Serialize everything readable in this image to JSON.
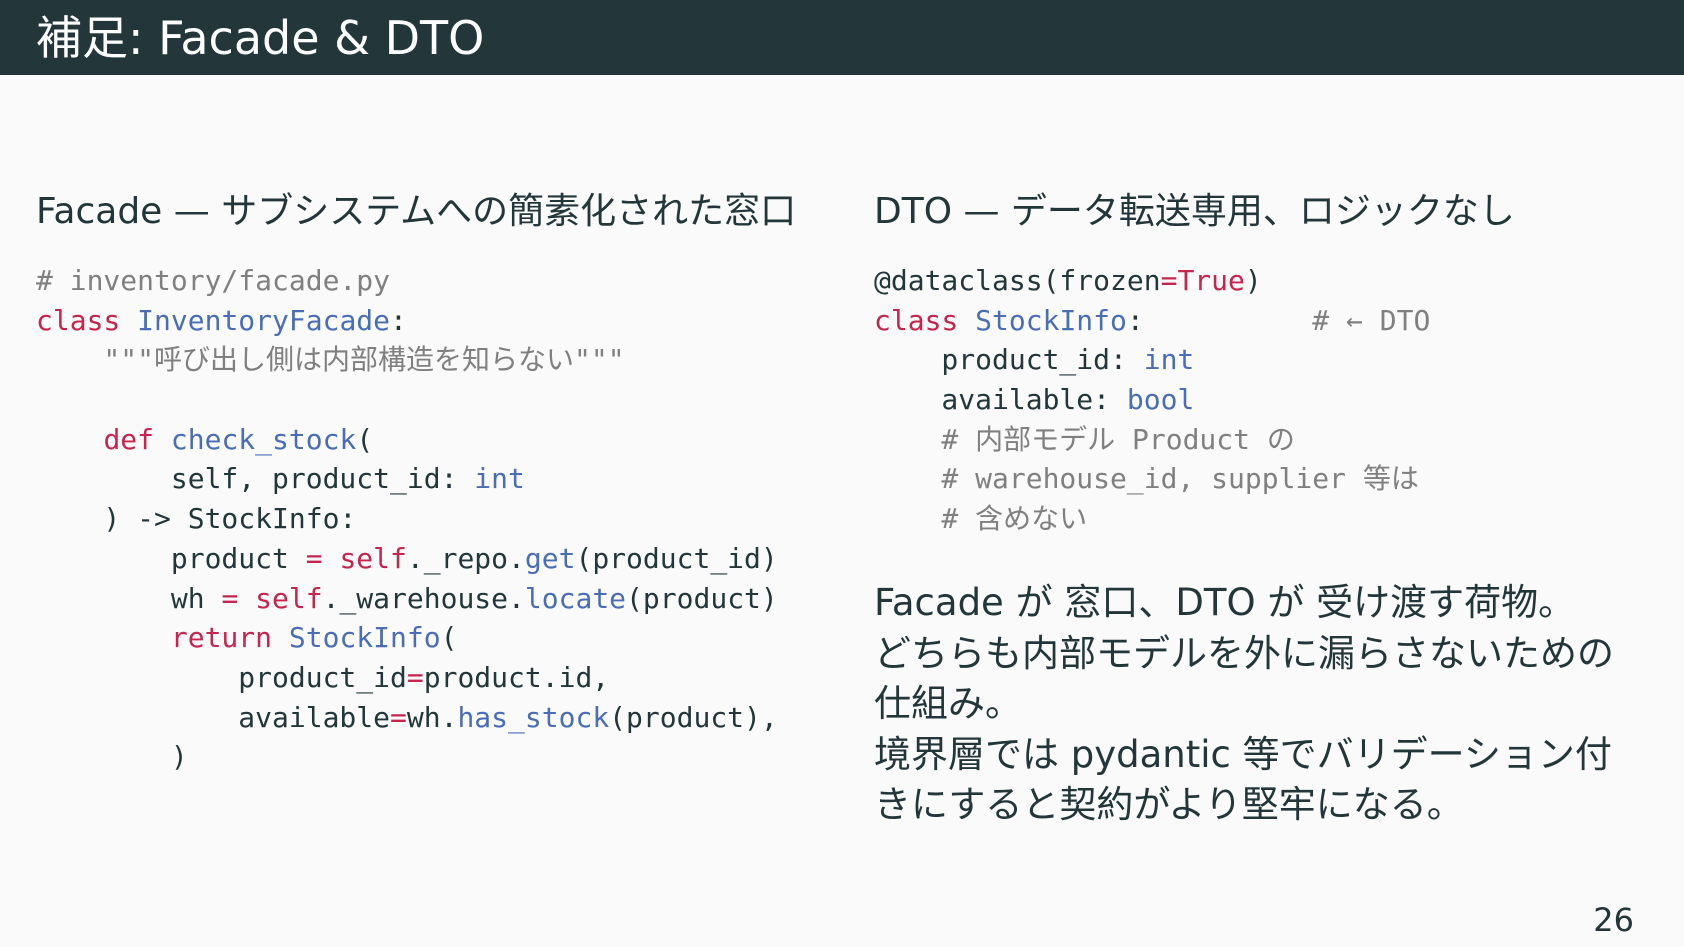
{
  "slide": {
    "title": "補足: Facade & DTO",
    "page_number": "26"
  },
  "left": {
    "heading": "Facade — サブシステムへの簡素化された窓口",
    "code_lines": [
      [
        {
          "t": "# inventory/facade.py",
          "c": "comment"
        }
      ],
      [
        {
          "t": "class",
          "c": "kw"
        },
        {
          "t": " ",
          "c": "plain"
        },
        {
          "t": "InventoryFacade",
          "c": "name"
        },
        {
          "t": ":",
          "c": "plain"
        }
      ],
      [
        {
          "t": "    \"\"\"呼び出し側は内部構造を知らない\"\"\"",
          "c": "comment"
        }
      ],
      [
        {
          "t": "",
          "c": "plain"
        }
      ],
      [
        {
          "t": "    ",
          "c": "plain"
        },
        {
          "t": "def",
          "c": "kw"
        },
        {
          "t": " ",
          "c": "plain"
        },
        {
          "t": "check_stock",
          "c": "name"
        },
        {
          "t": "(",
          "c": "plain"
        }
      ],
      [
        {
          "t": "        self, product_id: ",
          "c": "plain"
        },
        {
          "t": "int",
          "c": "name"
        }
      ],
      [
        {
          "t": "    ) -> StockInfo:",
          "c": "plain"
        }
      ],
      [
        {
          "t": "        product ",
          "c": "plain"
        },
        {
          "t": "=",
          "c": "kw"
        },
        {
          "t": " ",
          "c": "plain"
        },
        {
          "t": "self",
          "c": "kw"
        },
        {
          "t": "._repo.",
          "c": "plain"
        },
        {
          "t": "get",
          "c": "name"
        },
        {
          "t": "(product_id)",
          "c": "plain"
        }
      ],
      [
        {
          "t": "        wh ",
          "c": "plain"
        },
        {
          "t": "=",
          "c": "kw"
        },
        {
          "t": " ",
          "c": "plain"
        },
        {
          "t": "self",
          "c": "kw"
        },
        {
          "t": "._warehouse.",
          "c": "plain"
        },
        {
          "t": "locate",
          "c": "name"
        },
        {
          "t": "(product)",
          "c": "plain"
        }
      ],
      [
        {
          "t": "        ",
          "c": "plain"
        },
        {
          "t": "return",
          "c": "kw"
        },
        {
          "t": " ",
          "c": "plain"
        },
        {
          "t": "StockInfo",
          "c": "name"
        },
        {
          "t": "(",
          "c": "plain"
        }
      ],
      [
        {
          "t": "            product_id",
          "c": "plain"
        },
        {
          "t": "=",
          "c": "kw"
        },
        {
          "t": "product.id,",
          "c": "plain"
        }
      ],
      [
        {
          "t": "            available",
          "c": "plain"
        },
        {
          "t": "=",
          "c": "kw"
        },
        {
          "t": "wh.",
          "c": "plain"
        },
        {
          "t": "has_stock",
          "c": "name"
        },
        {
          "t": "(product),",
          "c": "plain"
        }
      ],
      [
        {
          "t": "        )",
          "c": "plain"
        }
      ]
    ]
  },
  "right": {
    "heading": "DTO — データ転送専用、ロジックなし",
    "code_lines": [
      [
        {
          "t": "@dataclass(frozen",
          "c": "plain"
        },
        {
          "t": "=",
          "c": "kw"
        },
        {
          "t": "True",
          "c": "kw"
        },
        {
          "t": ")",
          "c": "plain"
        }
      ],
      [
        {
          "t": "class",
          "c": "kw"
        },
        {
          "t": " ",
          "c": "plain"
        },
        {
          "t": "StockInfo",
          "c": "name"
        },
        {
          "t": ":",
          "c": "plain"
        },
        {
          "t": "          # ← DTO",
          "c": "comment"
        }
      ],
      [
        {
          "t": "    product_id: ",
          "c": "plain"
        },
        {
          "t": "int",
          "c": "name"
        }
      ],
      [
        {
          "t": "    available: ",
          "c": "plain"
        },
        {
          "t": "bool",
          "c": "name"
        }
      ],
      [
        {
          "t": "    # 内部モデル Product の",
          "c": "comment"
        }
      ],
      [
        {
          "t": "    # warehouse_id, supplier 等は",
          "c": "comment"
        }
      ],
      [
        {
          "t": "    # 含めない",
          "c": "comment"
        }
      ]
    ],
    "prose": [
      "Facade が 窓口、DTO が 受け渡す荷物。",
      "どちらも内部モデルを外に漏らさないための仕組み。",
      "境界層では pydantic 等でバリデーション付きにすると契約がより堅牢になる。"
    ]
  }
}
